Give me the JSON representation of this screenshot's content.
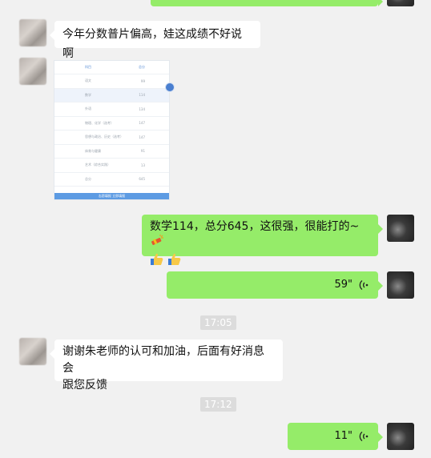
{
  "messages": {
    "msg1": "今年分数普片偏高，娃这成绩不好说啊",
    "msg2": "数学114，总分645，这很强，很能打的~",
    "msg3": "谢谢朱老师的认可和加油，后面有好消息会",
    "msg3b": "跟您反馈"
  },
  "voice": [
    {
      "duration": "59\""
    },
    {
      "duration": "11\""
    }
  ],
  "timestamps": [
    "17:05",
    "17:12"
  ],
  "screenshot_table": {
    "headers": [
      "科目",
      "总分"
    ],
    "rows": [
      [
        "语文",
        "99"
      ],
      [
        "数学",
        "114"
      ],
      [
        "外语",
        "134"
      ],
      [
        "物理、化学（选考）",
        "147"
      ],
      [
        "思想与政治、历史（选考）",
        "147"
      ],
      [
        "体育与健康",
        "91"
      ],
      [
        "艺术（综合实践）",
        "13"
      ],
      [
        "总分",
        "645"
      ]
    ],
    "button": "志愿填报 立即填报"
  },
  "colors": {
    "background": "#f1f1f1",
    "my_bubble": "#95ec69",
    "other_bubble": "#ffffff",
    "timestamp_bg": "#dcdcdc"
  },
  "icons": [
    "avatar",
    "voice-wave-icon",
    "firecracker-emoji-icon",
    "thumbs-up-emoji-icon"
  ]
}
